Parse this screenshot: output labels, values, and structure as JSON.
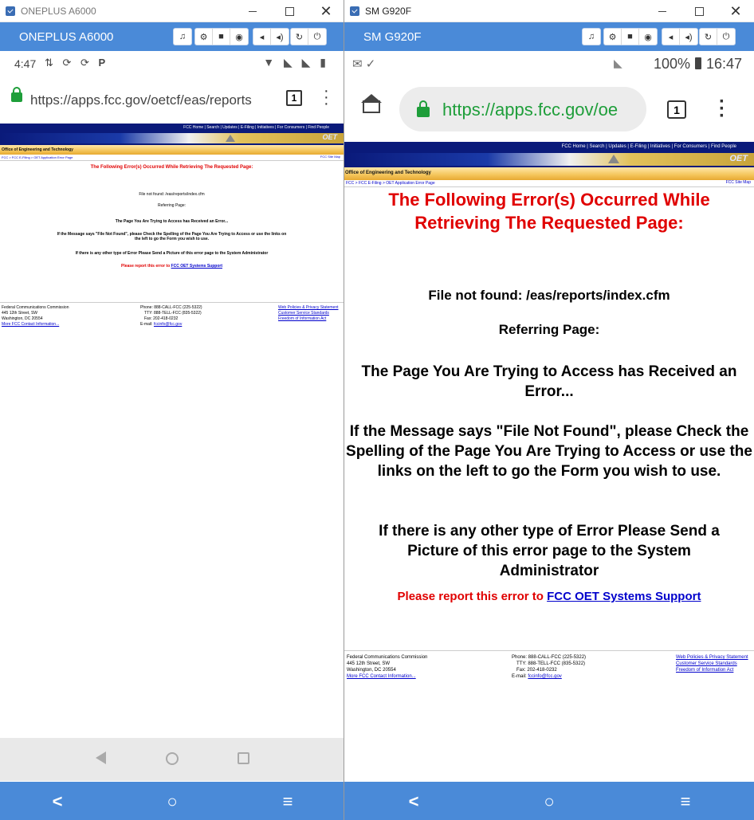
{
  "window_a": {
    "title": "ONEPLUS A6000",
    "device_label": "ONEPLUS A6000",
    "status_time": "4:47",
    "status_icons": [
      "sync-icon",
      "refresh-icon",
      "refresh-icon",
      "p-icon"
    ],
    "url": "https://apps.fcc.gov/oetcf/eas/reports",
    "tab_count": "1"
  },
  "window_b": {
    "title": "SM G920F",
    "device_label": "SM G920F",
    "status_battery": "100%",
    "status_time": "16:47",
    "url": "https://apps.fcc.gov/oe",
    "tab_count": "1"
  },
  "toolbar_icons": [
    "headset-icon",
    "gear-icon",
    "camera-video-icon",
    "camera-icon",
    "volume-down-icon",
    "volume-up-icon",
    "rotate-icon",
    "power-icon"
  ],
  "fcc_page": {
    "top_links": "FCC Home | Search | Updates | E-Filing | Initiatives | For Consumers | Find People",
    "logo_text": "OET",
    "office_title": "Office of Engineering and Technology",
    "breadcrumb": "FCC > FCC E-Filing > OET Application Error Page",
    "site_map": "FCC Site Map",
    "error_heading": "The Following Error(s) Occurred While Retrieving The Requested Page:",
    "file_not_found": "File not found: /eas/reports/index.cfm",
    "referring_page": "Referring Page:",
    "received_error": "The Page You Are Trying to Access has Received an Error...",
    "check_spelling": "If the Message says \"File Not Found\", please Check the Spelling of the Page You Are Trying to Access or use the links on the left to go the Form you wish to use.",
    "other_error": "If there is any other type of Error Please Send a Picture of this error page to the System Administrator",
    "report_prefix": "Please report this error to",
    "report_link": "FCC OET Systems Support",
    "footer": {
      "org": "Federal Communications Commission",
      "address1": "445 12th Street, SW",
      "address2": "Washington, DC 20554",
      "more_contact": "More FCC Contact Information...",
      "phone": "Phone: 888-CALL-FCC (225-5322)",
      "tty": "TTY: 888-TELL-FCC (835-5322)",
      "fax": "Fax: 202-418-0232",
      "email_label": "E-mail:",
      "email": "fccinfo@fcc.gov",
      "links": [
        "Web Policies & Privacy Statement",
        "Customer Service Standards",
        "Freedom of Information Act"
      ]
    }
  },
  "colors": {
    "toolbar_blue": "#4a8ad8",
    "fcc_navy": "#0a1a7a",
    "error_red": "#e00000",
    "link_blue": "#0000cc",
    "lock_green": "#1e9e3a"
  }
}
